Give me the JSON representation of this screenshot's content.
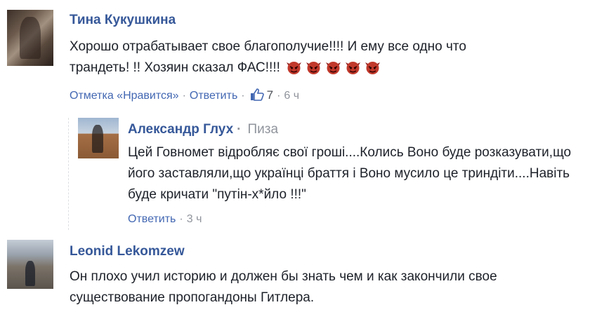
{
  "comments": [
    {
      "author": "Тина Кукушкина",
      "text": "Хорошо отрабатывает свое благополучие!!!! И ему все одно что трандеть! !! Хозяин сказал ФАС!!!!",
      "emoji": [
        "devil-emoji",
        "devil-emoji",
        "devil-emoji",
        "devil-emoji",
        "devil-emoji"
      ],
      "like_label": "Отметка «Нравится»",
      "reply_label": "Ответить",
      "like_count": "7",
      "time": "6 ч"
    },
    {
      "author": "Александр Глух",
      "location": "Пиза",
      "text": "Цей Говномет відробляє свої гроші....Колись Воно буде розказувати,що його заставляли,що українці браття і Воно мусило це триндіти....Навіть буде кричати \"путін-х*йло !!!\"",
      "reply_label": "Ответить",
      "time": "3 ч"
    },
    {
      "author": "Leonid Lekomzew",
      "text": "Он плохо учил историю и должен бы знать чем и как закончили свое существование пропогандоны Гитлера."
    }
  ],
  "colors": {
    "link": "#4267b2",
    "name": "#365899",
    "meta": "#90949c",
    "text": "#1d2129"
  }
}
